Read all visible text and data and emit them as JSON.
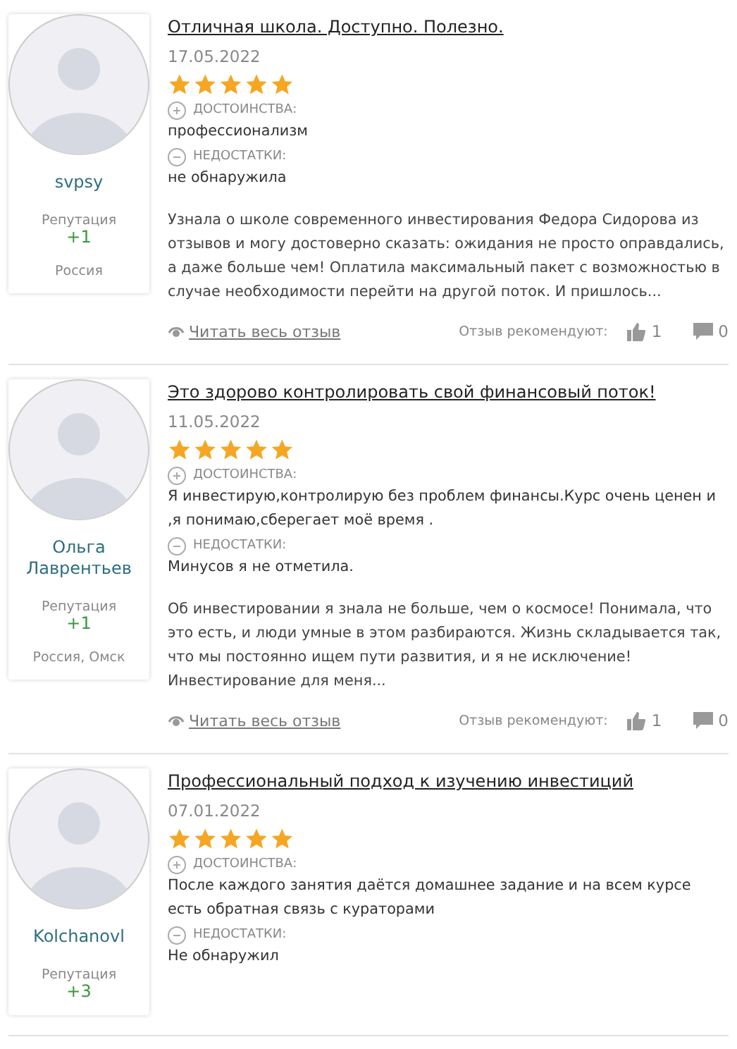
{
  "reviews": [
    {
      "author": {
        "name": "svpsy",
        "reputation_label": "Репутация",
        "reputation": "+1",
        "location": "Россия"
      },
      "title": "Отличная школа. Доступно. Полезно.",
      "date": "17.05.2022",
      "stars": 5,
      "pros_label": "ДОСТОИНСТВА:",
      "pros": "профессионализм",
      "cons_label": "НЕДОСТАТКИ:",
      "cons": "не обнаружила",
      "body": "Узнала о школе современного инвестирования Федора Сидорова из отзывов и могу достоверно сказать: ожидания не просто оправдались, а даже больше чем! Оплатила максимальный пакет с возможностью в случае необходимости перейти на другой поток. И пришлось...",
      "read_more": "Читать весь отзыв",
      "recommend_label": "Отзыв рекомендуют:",
      "likes": "1",
      "comments": "0"
    },
    {
      "author": {
        "name": "Ольга Лаврентьев",
        "reputation_label": "Репутация",
        "reputation": "+1",
        "location": "Россия, Омск"
      },
      "title": "Это здорово контролировать свой финансовый поток!",
      "date": "11.05.2022",
      "stars": 5,
      "pros_label": "ДОСТОИНСТВА:",
      "pros": "Я инвестирую,контролирую без проблем финансы.Курс очень ценен и ,я понимаю,сберегает моё время .",
      "cons_label": "НЕДОСТАТКИ:",
      "cons": "Минусов я не отметила.",
      "body": "Об инвестировании я знала не больше, чем о космосе! Понимала, что это есть, и люди умные в этом разбираются. Жизнь складывается так, что мы постоянно ищем пути развития, и я не исключение! Инвестирование для меня...",
      "read_more": "Читать весь отзыв",
      "recommend_label": "Отзыв рекомендуют:",
      "likes": "1",
      "comments": "0"
    },
    {
      "author": {
        "name": "Kolchanovl",
        "reputation_label": "Репутация",
        "reputation": "+3"
      },
      "title": "Профессиональный подход к изучению инвестиций",
      "date": "07.01.2022",
      "stars": 5,
      "pros_label": "ДОСТОИНСТВА:",
      "pros": "После каждого занятия даётся домашнее задание и на всем курсе есть обратная связь с кураторами",
      "cons_label": "НЕДОСТАТКИ:",
      "cons": "Не обнаружил"
    }
  ]
}
